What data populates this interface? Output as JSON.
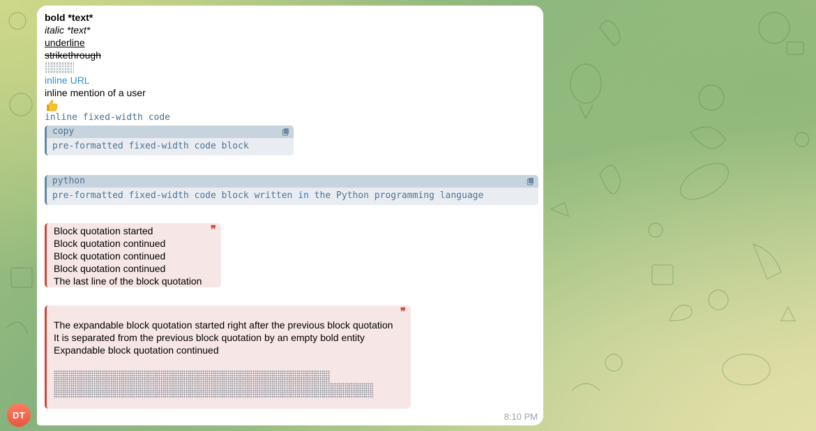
{
  "message": {
    "bold": "bold *text*",
    "italic": "italic *text*",
    "underline": "underline",
    "strikethrough": "strikethrough",
    "spoiler_icon": "spoiler-noise",
    "inline_url": "inline URL",
    "mention": "inline mention of a user",
    "emoji_icon": "thumbs-up-icon",
    "inline_code": "inline fixed-width code",
    "code_block_1": {
      "language": "copy",
      "code": "pre-formatted fixed-width code block"
    },
    "code_block_2": {
      "language": "python",
      "code_part1": "pre-formatted fixed-width code block written ",
      "code_keyword": "in",
      "code_part2": " the Python programming language"
    },
    "quote": {
      "lines": [
        "Block quotation started",
        "Block quotation continued",
        "Block quotation continued",
        "Block quotation continued",
        "The last line of the block quotation"
      ]
    },
    "expandable_quote": {
      "lines": [
        "The expandable block quotation started right after the previous block quotation",
        "It is separated from the previous block quotation by an empty bold entity",
        "Expandable block quotation continued"
      ]
    },
    "time": "8:10 PM"
  },
  "sender": {
    "initials": "DT",
    "avatar_color": "#e8563f"
  },
  "colors": {
    "link": "#3390c2",
    "quote_accent": "#d0463c",
    "code_accent": "#5f88a8"
  }
}
